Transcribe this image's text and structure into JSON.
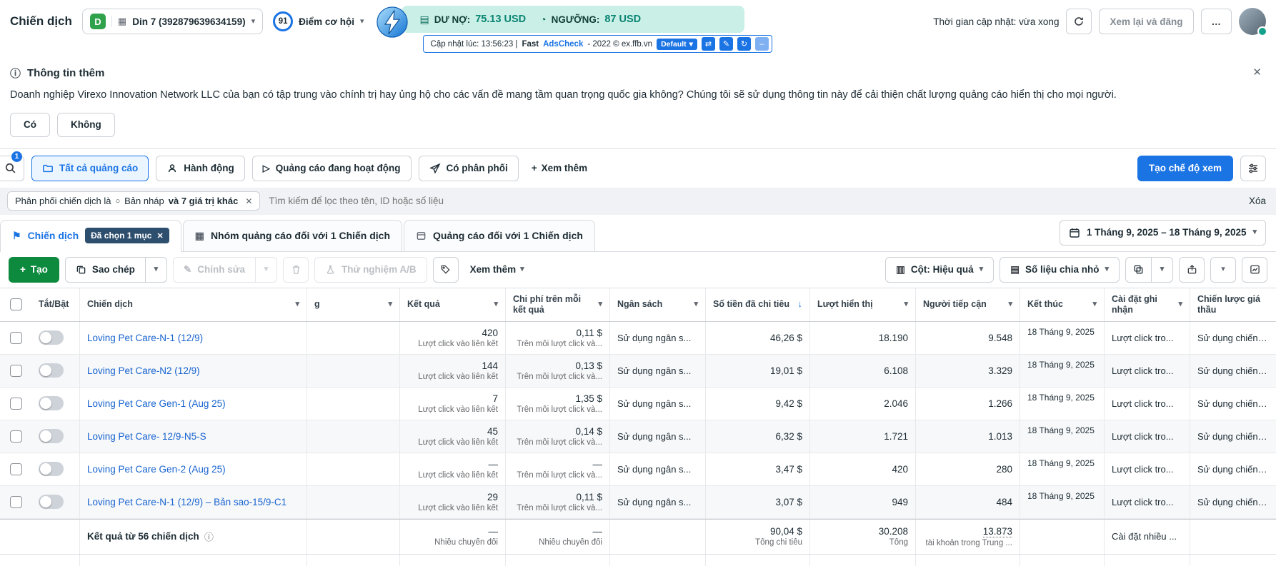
{
  "icons": {
    "caret": "▾",
    "close": "✕",
    "info_circle": "ⓘ",
    "play": "▷",
    "flag": "⚑",
    "grid": "▦",
    "columns": "▥",
    "rows": "▤",
    "gauge": "◔",
    "sort_desc": "↓",
    "plus": "+",
    "draft_circle": "○",
    "ellipsis": "…",
    "swap": "⇄",
    "pencil": "✎",
    "redo": "↻",
    "minimize": "–"
  },
  "topbar": {
    "title": "Chiến dịch",
    "account_initial": "D",
    "account_name": "Din 7 (392879639634159)",
    "score_value": "91",
    "score_label": "Điểm cơ hội",
    "debt_label": "DƯ NỢ:",
    "debt_value": "75.13 USD",
    "threshold_label": "NGƯỠNG:",
    "threshold_value": "87 USD",
    "adscheck_prefix": "Cập nhật lúc: 13:56:23 |",
    "adscheck_fast": "Fast",
    "adscheck_brand": "AdsCheck",
    "adscheck_suffix": "- 2022 © ex.ffb.vn",
    "adscheck_default": "Default",
    "update_time": "Thời gian cập nhật: vừa xong",
    "review_button": "Xem lại và đăng"
  },
  "info_banner": {
    "title": "Thông tin thêm",
    "message": "Doanh nghiệp Virexo Innovation Network LLC của bạn có tập trung vào chính trị hay ủng hộ cho các vấn đề mang tầm quan trọng quốc gia không? Chúng tôi sẽ sử dụng thông tin này để cải thiện chất lượng quảng cáo hiển thị cho mọi người.",
    "yes": "Có",
    "no": "Không"
  },
  "filter_bar": {
    "search_badge": "1",
    "all_ads": "Tất cả quảng cáo",
    "actions": "Hành động",
    "active_ads": "Quảng cáo đang hoạt động",
    "has_delivery": "Có phân phối",
    "see_more": "Xem thêm",
    "create_view": "Tạo chế độ xem"
  },
  "filter_row": {
    "chip_prefix": "Phân phối chiến dịch là",
    "chip_value": "Bản nháp",
    "chip_extra": "và 7 giá trị khác",
    "search_placeholder": "Tìm kiếm để lọc theo tên, ID hoặc số liệu",
    "clear": "Xóa"
  },
  "tabs": {
    "campaign": "Chiến dịch",
    "selected_badge": "Đã chọn 1 mục",
    "adset": "Nhóm quảng cáo đối với 1 Chiến dịch",
    "ad": "Quảng cáo đối với 1 Chiến dịch",
    "date_range": "1 Tháng 9, 2025 – 18 Tháng 9, 2025"
  },
  "toolbar": {
    "create": "Tạo",
    "duplicate": "Sao chép",
    "edit": "Chỉnh sửa",
    "ab_test": "Thử nghiệm A/B",
    "see_more": "Xem thêm",
    "columns": "Cột: Hiệu quả",
    "breakdown": "Số liệu chia nhỏ"
  },
  "table": {
    "headers": {
      "toggle": "Tắt/Bật",
      "campaign": "Chiến dịch",
      "partial": "g",
      "results": "Kết quả",
      "cost_per_result": "Chi phí trên mỗi kết quả",
      "budget": "Ngân sách",
      "amount_spent": "Số tiền đã chi tiêu",
      "impressions": "Lượt hiển thị",
      "reach": "Người tiếp cận",
      "end": "Kết thúc",
      "attribution": "Cài đặt ghi nhận",
      "bid_strategy": "Chiến lược giá thầu"
    },
    "result_sub": "Lượt click vào liên kết",
    "cost_sub": "Trên mỗi lượt click và...",
    "budget_text": "Sử dụng ngân s...",
    "attribution_text": "Lượt click tro...",
    "bid_text": "Sử dụng chiến l...",
    "rows": [
      {
        "name": "Loving Pet Care-N-1 (12/9)",
        "results": "420",
        "cost": "0,11 $",
        "spent": "46,26 $",
        "impressions": "18.190",
        "reach": "9.548",
        "end": "18 Tháng 9, 2025"
      },
      {
        "name": "Loving Pet Care-N2 (12/9)",
        "results": "144",
        "cost": "0,13 $",
        "spent": "19,01 $",
        "impressions": "6.108",
        "reach": "3.329",
        "end": "18 Tháng 9, 2025"
      },
      {
        "name": "Loving Pet Care Gen-1 (Aug 25)",
        "results": "7",
        "cost": "1,35 $",
        "spent": "9,42 $",
        "impressions": "2.046",
        "reach": "1.266",
        "end": "18 Tháng 9, 2025"
      },
      {
        "name": "Loving Pet Care- 12/9-N5-S",
        "results": "45",
        "cost": "0,14 $",
        "spent": "6,32 $",
        "impressions": "1.721",
        "reach": "1.013",
        "end": "18 Tháng 9, 2025"
      },
      {
        "name": "Loving Pet Care Gen-2 (Aug 25)",
        "results": "—",
        "cost": "—",
        "spent": "3,47 $",
        "impressions": "420",
        "reach": "280",
        "end": "18 Tháng 9, 2025"
      },
      {
        "name": "Loving Pet Care-N-1 (12/9) – Bản sao-15/9-C1",
        "results": "29",
        "cost": "0,11 $",
        "spent": "3,07 $",
        "impressions": "949",
        "reach": "484",
        "end": "18 Tháng 9, 2025"
      }
    ],
    "footer": {
      "label": "Kết quả từ 56 chiến dịch",
      "results": "—",
      "results_sub": "Nhiều chuyển đổi",
      "cost": "—",
      "cost_sub": "Nhiều chuyển đổi",
      "spent": "90,04 $",
      "spent_sub": "Tổng chi tiêu",
      "impressions": "30.208",
      "impressions_sub": "Tổng",
      "reach": "13.873",
      "reach_sub": "tài khoản trong Trung ...",
      "attribution": "Cài đặt nhiều ..."
    }
  }
}
